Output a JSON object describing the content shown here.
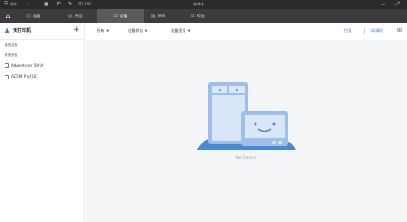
{
  "titlebar": {
    "menu_label": "文件",
    "zoom_label": "100",
    "title": "未命名"
  },
  "tabs": [
    {
      "label": "准备",
      "active": false
    },
    {
      "label": "预览",
      "active": false
    },
    {
      "label": "设备",
      "active": true
    },
    {
      "label": "项目",
      "active": false
    },
    {
      "label": "校准",
      "active": false
    }
  ],
  "sidebar": {
    "title": "无打印机",
    "add_label": "+",
    "sections": [
      {
        "label": "我的设备"
      },
      {
        "label": "其他设备"
      }
    ],
    "devices": [
      {
        "label": "Adventurer 5M-A"
      },
      {
        "label": "AD5M Pro打印"
      }
    ]
  },
  "toolbar": {
    "filters": [
      {
        "label": "所有"
      },
      {
        "label": "设备状态"
      },
      {
        "label": "设备型号"
      }
    ],
    "right_links": [
      {
        "label": "扫描"
      },
      {
        "label": "局域网"
      }
    ]
  },
  "main": {
    "empty_text": "No Device"
  },
  "colors": {
    "accent": "#3a7bd5",
    "titlebar_bg": "#2b2b2b",
    "tabbar_bg": "#3c3c3c",
    "active_tab_bg": "#5a5a5a",
    "main_bg": "#f4f5f7",
    "illustration_light": "#d8e6f7",
    "illustration_mid": "#9cc0ea",
    "illustration_dark": "#4a89d6"
  }
}
